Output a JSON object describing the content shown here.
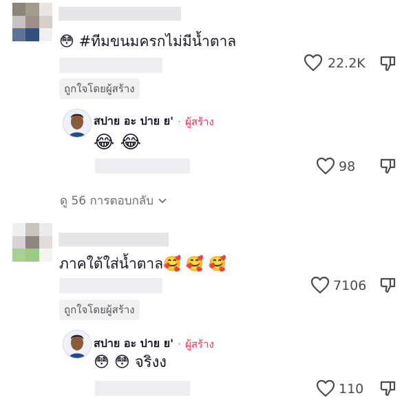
{
  "comments": [
    {
      "text": "😳 #ทีมขนมครกไม่มีน้ำตาล",
      "likes": "22.2K",
      "creator_liked": "ถูกใจโดยผู้สร้าง",
      "reply": {
        "author": "สปาย อะ ปาย ย'",
        "separator": "·",
        "tag": "ผู้สร้าง",
        "text": "😂 😂",
        "likes": "98"
      },
      "view_replies": "ดู 56 การตอบกลับ"
    },
    {
      "text": "ภาคใต้ใส่น้ำตาล🥰 🥰 🥰",
      "likes": "7106",
      "creator_liked": "ถูกใจโดยผู้สร้าง",
      "reply": {
        "author": "สปาย อะ ปาย ย'",
        "separator": "·",
        "tag": "ผู้สร้าง",
        "text": "😳 😳  จริงง",
        "likes": "110"
      }
    }
  ],
  "icons": [
    "heart-outline-icon",
    "thumb-down-icon",
    "chevron-down-icon"
  ],
  "colors": {
    "creator_tag": "#fe2c55",
    "text": "#161823",
    "muted": "#6b6c72"
  }
}
